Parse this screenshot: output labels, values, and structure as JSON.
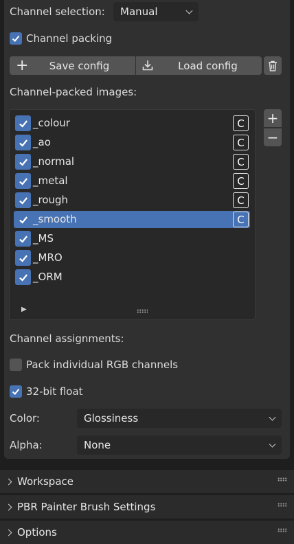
{
  "channel_selection": {
    "label": "Channel selection:",
    "value": "Manual"
  },
  "channel_packing": {
    "label": "Channel packing",
    "checked": true
  },
  "config": {
    "save_label": "Save config",
    "load_label": "Load config"
  },
  "images_header": "Channel-packed images:",
  "images": [
    {
      "name": "_colour",
      "checked": true,
      "badge": "C"
    },
    {
      "name": "_ao",
      "checked": true,
      "badge": "C"
    },
    {
      "name": "_normal",
      "checked": true,
      "badge": "C"
    },
    {
      "name": "_metal",
      "checked": true,
      "badge": "C"
    },
    {
      "name": "_rough",
      "checked": true,
      "badge": "C"
    },
    {
      "name": "_smooth",
      "checked": true,
      "badge": "C",
      "selected": true
    },
    {
      "name": "_MS",
      "checked": true
    },
    {
      "name": "_MRO",
      "checked": true
    },
    {
      "name": "_ORM",
      "checked": true
    }
  ],
  "assignments_header": "Channel assignments:",
  "pack_rgb": {
    "label": "Pack individual RGB channels",
    "checked": false
  },
  "float32": {
    "label": "32-bit float",
    "checked": true
  },
  "color_field": {
    "label": "Color:",
    "value": "Glossiness"
  },
  "alpha_field": {
    "label": "Alpha:",
    "value": "None"
  },
  "sections": [
    {
      "title": "Workspace"
    },
    {
      "title": "PBR Painter Brush Settings"
    },
    {
      "title": "Options"
    }
  ],
  "colors": {
    "accent": "#4772b3",
    "panel": "#303030",
    "field": "#282828",
    "button": "#545454"
  }
}
